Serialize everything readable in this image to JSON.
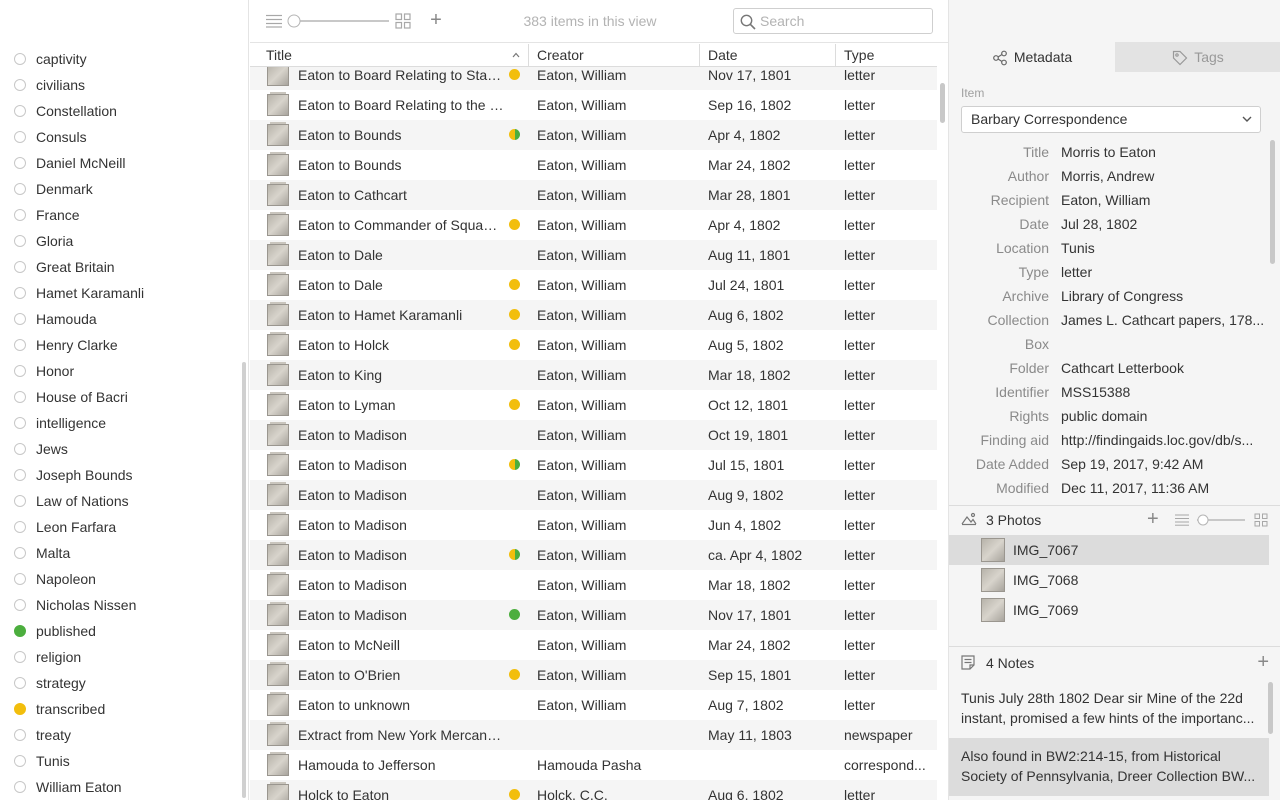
{
  "sidebar": {
    "tags": [
      {
        "label": "captivity",
        "color": ""
      },
      {
        "label": "civilians",
        "color": ""
      },
      {
        "label": "Constellation",
        "color": ""
      },
      {
        "label": "Consuls",
        "color": ""
      },
      {
        "label": "Daniel McNeill",
        "color": ""
      },
      {
        "label": "Denmark",
        "color": ""
      },
      {
        "label": "France",
        "color": ""
      },
      {
        "label": "Gloria",
        "color": ""
      },
      {
        "label": "Great Britain",
        "color": ""
      },
      {
        "label": "Hamet Karamanli",
        "color": ""
      },
      {
        "label": "Hamouda",
        "color": ""
      },
      {
        "label": "Henry Clarke",
        "color": ""
      },
      {
        "label": "Honor",
        "color": ""
      },
      {
        "label": "House of Bacri",
        "color": ""
      },
      {
        "label": "intelligence",
        "color": ""
      },
      {
        "label": "Jews",
        "color": ""
      },
      {
        "label": "Joseph Bounds",
        "color": ""
      },
      {
        "label": "Law of Nations",
        "color": ""
      },
      {
        "label": "Leon Farfara",
        "color": ""
      },
      {
        "label": "Malta",
        "color": ""
      },
      {
        "label": "Napoleon",
        "color": ""
      },
      {
        "label": "Nicholas Nissen",
        "color": ""
      },
      {
        "label": "published",
        "color": "green"
      },
      {
        "label": "religion",
        "color": ""
      },
      {
        "label": "strategy",
        "color": ""
      },
      {
        "label": "transcribed",
        "color": "yellow"
      },
      {
        "label": "treaty",
        "color": ""
      },
      {
        "label": "Tunis",
        "color": ""
      },
      {
        "label": "William Eaton",
        "color": ""
      }
    ]
  },
  "toolbar": {
    "count_text": "383 items in this view",
    "search_placeholder": "Search"
  },
  "table": {
    "columns": {
      "title": "Title",
      "creator": "Creator",
      "date": "Date",
      "type": "Type"
    },
    "rows": [
      {
        "title": "Eaton to Board Relating to State...",
        "creator": "Eaton, William",
        "date": "Nov 17, 1801",
        "type": "letter",
        "dot": "yellow"
      },
      {
        "title": "Eaton to Board Relating to the Unit...",
        "creator": "Eaton, William",
        "date": "Sep 16, 1802",
        "type": "letter",
        "dot": ""
      },
      {
        "title": "Eaton to Bounds",
        "creator": "Eaton, William",
        "date": "Apr 4, 1802",
        "type": "letter",
        "dot": "both"
      },
      {
        "title": "Eaton to Bounds",
        "creator": "Eaton, William",
        "date": "Mar 24, 1802",
        "type": "letter",
        "dot": ""
      },
      {
        "title": "Eaton to Cathcart",
        "creator": "Eaton, William",
        "date": "Mar 28, 1801",
        "type": "letter",
        "dot": ""
      },
      {
        "title": "Eaton to Commander of Squadr...",
        "creator": "Eaton, William",
        "date": "Apr 4, 1802",
        "type": "letter",
        "dot": "yellow"
      },
      {
        "title": "Eaton to Dale",
        "creator": "Eaton, William",
        "date": "Aug 11, 1801",
        "type": "letter",
        "dot": ""
      },
      {
        "title": "Eaton to Dale",
        "creator": "Eaton, William",
        "date": "Jul 24, 1801",
        "type": "letter",
        "dot": "yellow"
      },
      {
        "title": "Eaton to Hamet Karamanli",
        "creator": "Eaton, William",
        "date": "Aug 6, 1802",
        "type": "letter",
        "dot": "yellow"
      },
      {
        "title": "Eaton to Holck",
        "creator": "Eaton, William",
        "date": "Aug 5, 1802",
        "type": "letter",
        "dot": "yellow"
      },
      {
        "title": "Eaton to King",
        "creator": "Eaton, William",
        "date": "Mar 18, 1802",
        "type": "letter",
        "dot": ""
      },
      {
        "title": "Eaton to Lyman",
        "creator": "Eaton, William",
        "date": "Oct 12, 1801",
        "type": "letter",
        "dot": "yellow"
      },
      {
        "title": "Eaton to Madison",
        "creator": "Eaton, William",
        "date": "Oct 19, 1801",
        "type": "letter",
        "dot": ""
      },
      {
        "title": "Eaton to Madison",
        "creator": "Eaton, William",
        "date": "Jul 15, 1801",
        "type": "letter",
        "dot": "both"
      },
      {
        "title": "Eaton to Madison",
        "creator": "Eaton, William",
        "date": "Aug 9, 1802",
        "type": "letter",
        "dot": ""
      },
      {
        "title": "Eaton to Madison",
        "creator": "Eaton, William",
        "date": "Jun 4, 1802",
        "type": "letter",
        "dot": ""
      },
      {
        "title": "Eaton to Madison",
        "creator": "Eaton, William",
        "date": "ca. Apr 4, 1802",
        "type": "letter",
        "dot": "both"
      },
      {
        "title": "Eaton to Madison",
        "creator": "Eaton, William",
        "date": "Mar 18, 1802",
        "type": "letter",
        "dot": ""
      },
      {
        "title": "Eaton to Madison",
        "creator": "Eaton, William",
        "date": "Nov 17, 1801",
        "type": "letter",
        "dot": "green"
      },
      {
        "title": "Eaton to McNeill",
        "creator": "Eaton, William",
        "date": "Mar 24, 1802",
        "type": "letter",
        "dot": ""
      },
      {
        "title": "Eaton to O'Brien",
        "creator": "Eaton, William",
        "date": "Sep 15, 1801",
        "type": "letter",
        "dot": "yellow"
      },
      {
        "title": "Eaton to unknown",
        "creator": "Eaton, William",
        "date": "Aug 7, 1802",
        "type": "letter",
        "dot": ""
      },
      {
        "title": "Extract from New York Mercantile ...",
        "creator": "",
        "date": "May 11, 1803",
        "type": "newspaper",
        "dot": ""
      },
      {
        "title": "Hamouda to Jefferson",
        "creator": "Hamouda Pasha",
        "date": "",
        "type": "correspond...",
        "dot": ""
      },
      {
        "title": "Holck to Eaton",
        "creator": "Holck, C.C.",
        "date": "Aug 6, 1802",
        "type": "letter",
        "dot": "yellow"
      }
    ]
  },
  "right": {
    "tabs": {
      "metadata": "Metadata",
      "tags": "Tags"
    },
    "item_label": "Item",
    "item_select": "Barbary Correspondence",
    "metadata": [
      {
        "key": "Title",
        "value": "Morris to Eaton"
      },
      {
        "key": "Author",
        "value": "Morris, Andrew"
      },
      {
        "key": "Recipient",
        "value": "Eaton, William"
      },
      {
        "key": "Date",
        "value": "Jul 28, 1802"
      },
      {
        "key": "Location",
        "value": "Tunis"
      },
      {
        "key": "Type",
        "value": "letter"
      },
      {
        "key": "Archive",
        "value": "Library of Congress"
      },
      {
        "key": "Collection",
        "value": "James L. Cathcart papers, 178..."
      },
      {
        "key": "Box",
        "value": ""
      },
      {
        "key": "Folder",
        "value": "Cathcart Letterbook"
      },
      {
        "key": "Identifier",
        "value": "MSS15388"
      },
      {
        "key": "Rights",
        "value": "public domain"
      },
      {
        "key": "Finding aid",
        "value": "http://findingaids.loc.gov/db/s..."
      },
      {
        "key": "Date Added",
        "value": "Sep 19, 2017, 9:42 AM"
      },
      {
        "key": "Modified",
        "value": "Dec 11, 2017, 11:36 AM"
      }
    ],
    "photos_title": "3 Photos",
    "photos": [
      "IMG_7067",
      "IMG_7068",
      "IMG_7069"
    ],
    "notes_title": "4 Notes",
    "notes": [
      {
        "line1": "Tunis July 28th 1802 Dear sir Mine of the 22d",
        "line2": "instant, promised a few hints of the importanc..."
      },
      {
        "line1": "Also found in BW2:214-15, from Historical",
        "line2": "Society of Pennsylvania, Dreer Collection BW..."
      }
    ]
  }
}
